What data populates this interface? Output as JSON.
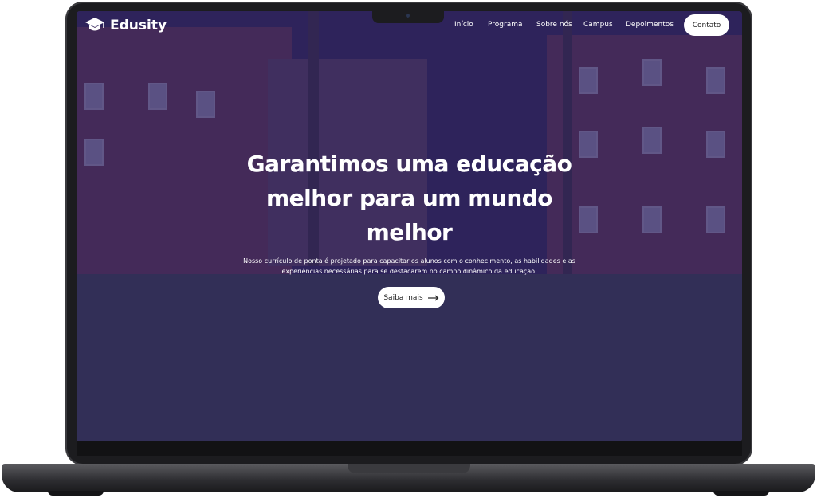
{
  "brand": {
    "name": "Edusity",
    "logo_icon": "graduation-cap-icon"
  },
  "nav": {
    "items": [
      "Início",
      "Programa",
      "Sobre nós",
      "Campus",
      "Depoimentos"
    ],
    "contact_label": "Contato"
  },
  "hero": {
    "title": "Garantimos uma educação melhor para um mundo melhor",
    "description": "Nosso currículo de ponta é projetado para capacitar os alunos com o conhecimento, as habilidades e as experiências necessárias para se destacarem no campo dinâmico da educação.",
    "cta_label": "Saiba mais",
    "cta_icon": "arrow-right-icon"
  },
  "colors": {
    "overlay": "#2a1e5c",
    "accent": "#ffffff"
  }
}
